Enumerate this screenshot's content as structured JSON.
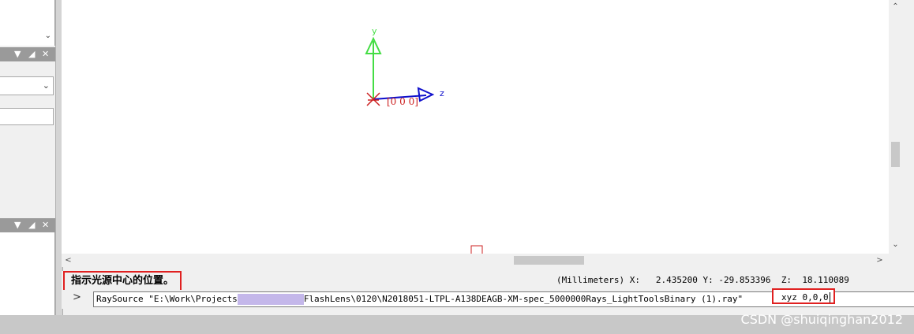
{
  "viewport": {
    "axes": {
      "y_label": "y",
      "z_label": "z",
      "origin_label": "[0 0 0]"
    }
  },
  "status": {
    "message": "指示光源中心的位置。",
    "units": "(Millimeters)",
    "x_label": "X:",
    "x_value": "2.435200",
    "y_label": "Y:",
    "y_value": "-29.853396",
    "z_label": "Z:",
    "z_value": "18.110089"
  },
  "command": {
    "prompt": ">",
    "text_before": "RaySource \"E:\\Work\\Projects",
    "text_after": "FlashLens\\0120\\N2018051-LTPL-A138DEAGB-XM-spec_5000000Rays_LightToolsBinary (1).ray\"",
    "input_value": "xyz 0,0,0"
  },
  "watermark": "CSDN @shuiqinghan2012",
  "colors": {
    "y_axis": "#44dd44",
    "z_axis": "#1010cc",
    "origin": "#cc2020",
    "highlight_box": "#e02020"
  }
}
